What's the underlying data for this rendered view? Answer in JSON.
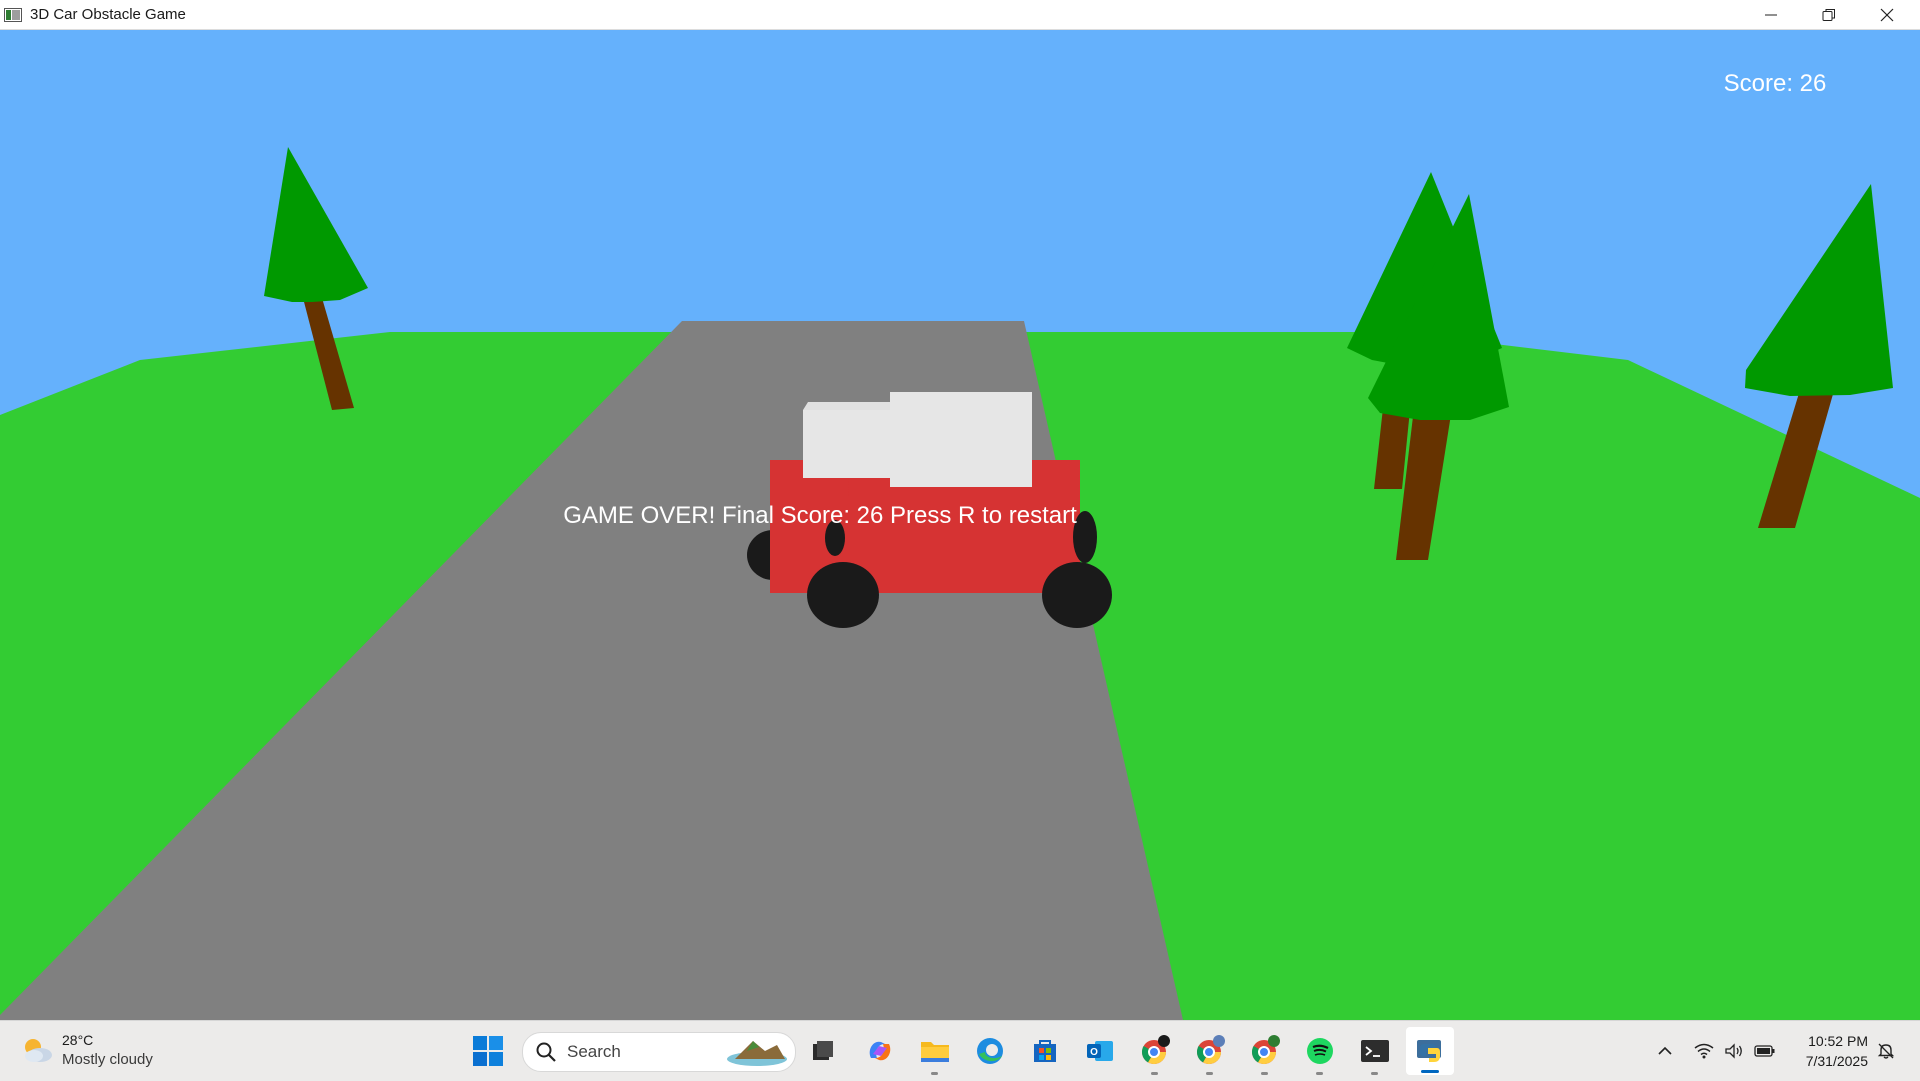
{
  "window": {
    "title": "3D Car Obstacle Game",
    "controls": [
      "minimize-icon",
      "restore-icon",
      "close-icon"
    ]
  },
  "game": {
    "score_text": "Score: 26",
    "game_over_text": "GAME OVER! Final Score: 26 Press R to restart",
    "colors": {
      "sky": "#65b1fc",
      "grass": "#33cc33",
      "road": "#808080",
      "car_body": "#d63333",
      "car_cabin": "#e6e6e6",
      "wheel": "#1a1a1a",
      "tree_foliage": "#009900",
      "tree_trunk": "#663300"
    }
  },
  "taskbar": {
    "weather": {
      "temperature": "28°C",
      "condition": "Mostly cloudy",
      "icon": "partly-cloudy-icon"
    },
    "search": {
      "label": "Search"
    },
    "apps": [
      {
        "name": "task-view"
      },
      {
        "name": "copilot"
      },
      {
        "name": "file-explorer"
      },
      {
        "name": "edge"
      },
      {
        "name": "microsoft-store"
      },
      {
        "name": "outlook"
      },
      {
        "name": "chrome-profile-1"
      },
      {
        "name": "chrome-profile-2"
      },
      {
        "name": "chrome-profile-3"
      },
      {
        "name": "spotify"
      },
      {
        "name": "terminal"
      },
      {
        "name": "python-game"
      }
    ],
    "tray": {
      "icons": [
        "chevron-up-icon",
        "wifi-icon",
        "volume-icon",
        "battery-icon"
      ],
      "time": "10:52 PM",
      "date": "7/31/2025",
      "notification_icon": "bell-icon"
    }
  }
}
